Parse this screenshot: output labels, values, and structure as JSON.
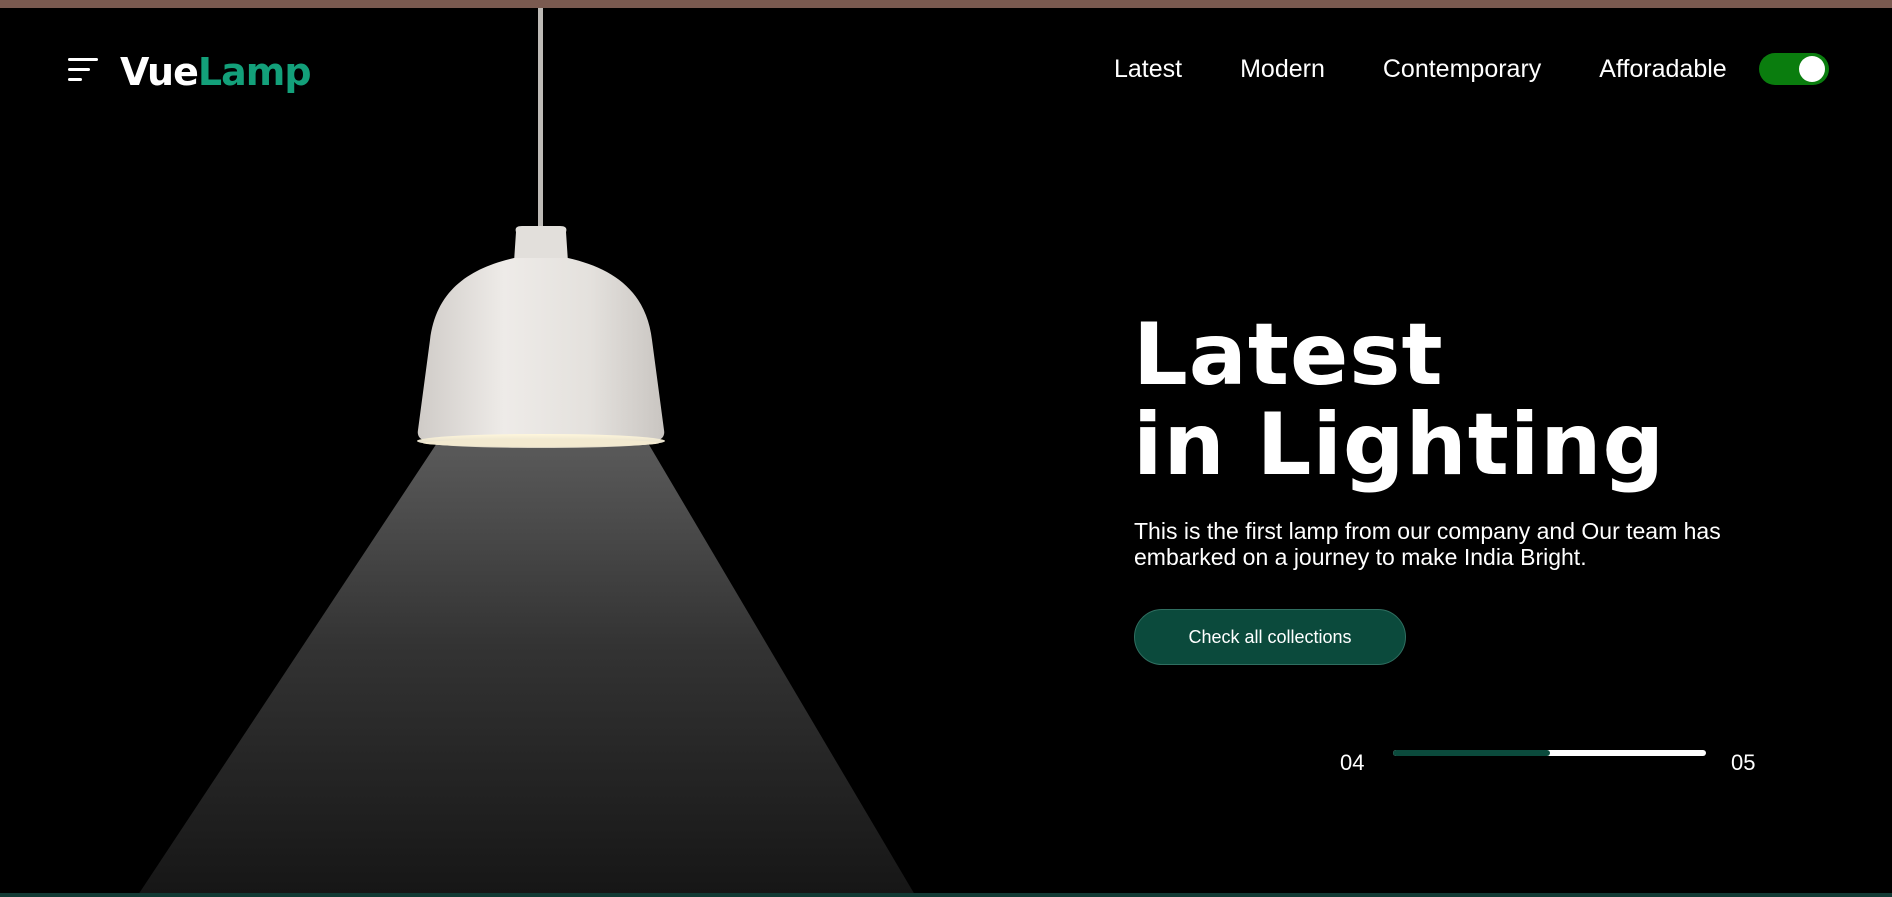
{
  "header": {
    "logo": {
      "part1": "Vue",
      "part2": "Lamp"
    },
    "menu_icon": "hamburger-menu-icon",
    "nav": [
      {
        "label": "Latest"
      },
      {
        "label": "Modern"
      },
      {
        "label": "Contemporary"
      },
      {
        "label": "Afforadable"
      }
    ],
    "toggle": {
      "state": "on",
      "color": "#0a7d0e"
    }
  },
  "hero": {
    "title_line1": "Latest",
    "title_line2": "in Lighting",
    "description": "This is the first lamp from our company and Our team has embarked on a journey to make India Bright.",
    "cta_label": "Check all collections"
  },
  "slider": {
    "current": "04",
    "total": "05",
    "progress_fraction": 0.5
  },
  "colors": {
    "brand_green": "#13a07a",
    "dark_green": "#0b4a3c",
    "toggle_green": "#0a7d0e",
    "top_strip": "#7a5a50",
    "background": "#000000"
  }
}
